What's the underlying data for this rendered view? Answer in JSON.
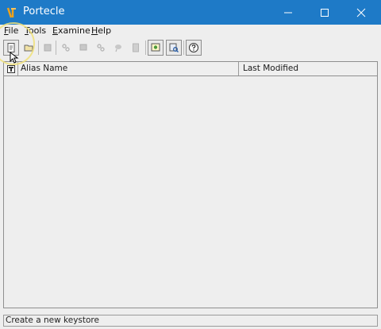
{
  "window": {
    "title": "Portecle"
  },
  "menu": [
    {
      "underline": "F",
      "rest": "ile"
    },
    {
      "underline": "T",
      "rest": "ools"
    },
    {
      "underline": "E",
      "rest": "xamine"
    },
    {
      "underline": "H",
      "rest": "elp"
    }
  ],
  "table": {
    "columns": [
      "Alias Name",
      "Last Modified"
    ],
    "rows": []
  },
  "status": {
    "text": "Create a new keystore"
  },
  "colors": {
    "titlebar": "#1e7ac7",
    "window_bg": "#eeeeee"
  },
  "toolbar": {
    "buttons": [
      {
        "icon": "new-keystore-icon",
        "enabled": true
      },
      {
        "icon": "open-keystore-icon",
        "enabled": true
      },
      {
        "icon": "save-keystore-icon",
        "enabled": false
      },
      {
        "icon": "generate-keypair-icon",
        "enabled": false
      },
      {
        "icon": "import-trusted-cert-icon",
        "enabled": false
      },
      {
        "icon": "import-keypair-icon",
        "enabled": false
      },
      {
        "icon": "set-password-icon",
        "enabled": false
      },
      {
        "icon": "keystore-report-icon",
        "enabled": false
      },
      {
        "icon": "examine-certificate-icon",
        "enabled": true
      },
      {
        "icon": "examine-csr-icon",
        "enabled": true
      },
      {
        "icon": "help-icon",
        "enabled": true
      }
    ]
  }
}
